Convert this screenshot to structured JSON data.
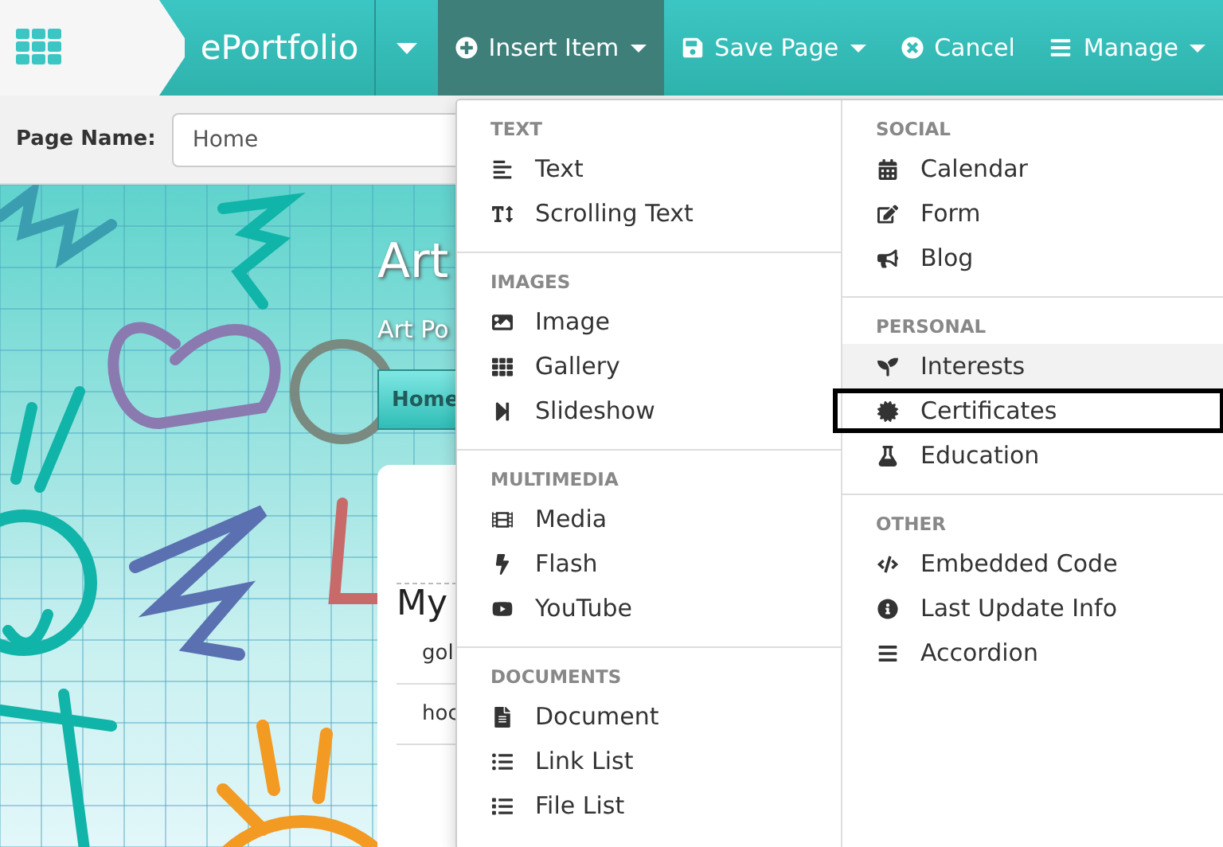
{
  "topbar": {
    "brand": "ePortfolio",
    "menus": [
      {
        "label": "Insert Item",
        "selected": true,
        "caret": true
      },
      {
        "label": "Save Page",
        "selected": false,
        "caret": true
      },
      {
        "label": "Cancel",
        "selected": false,
        "caret": false
      },
      {
        "label": "Manage",
        "selected": false,
        "caret": true
      }
    ]
  },
  "page_name": {
    "label": "Page Name:",
    "value": "Home"
  },
  "site": {
    "title": "Art",
    "subtitle": "Art Po",
    "nav_button": "Home",
    "card_heading": "My",
    "card_rows": [
      "gol",
      "hoc"
    ]
  },
  "insert_menu": {
    "columns": [
      [
        {
          "heading": "TEXT",
          "items": [
            {
              "label": "Text",
              "hovered": false,
              "outlined": false
            },
            {
              "label": "Scrolling Text",
              "hovered": false,
              "outlined": false
            }
          ]
        },
        {
          "heading": "IMAGES",
          "items": [
            {
              "label": "Image",
              "hovered": false,
              "outlined": false
            },
            {
              "label": "Gallery",
              "hovered": false,
              "outlined": false
            },
            {
              "label": "Slideshow",
              "hovered": false,
              "outlined": false
            }
          ]
        },
        {
          "heading": "MULTIMEDIA",
          "items": [
            {
              "label": "Media",
              "hovered": false,
              "outlined": false
            },
            {
              "label": "Flash",
              "hovered": false,
              "outlined": false
            },
            {
              "label": "YouTube",
              "hovered": false,
              "outlined": false
            }
          ]
        },
        {
          "heading": "DOCUMENTS",
          "items": [
            {
              "label": "Document",
              "hovered": false,
              "outlined": false
            },
            {
              "label": "Link List",
              "hovered": false,
              "outlined": false
            },
            {
              "label": "File List",
              "hovered": false,
              "outlined": false
            }
          ]
        }
      ],
      [
        {
          "heading": "SOCIAL",
          "items": [
            {
              "label": "Calendar",
              "hovered": false,
              "outlined": false
            },
            {
              "label": "Form",
              "hovered": false,
              "outlined": false
            },
            {
              "label": "Blog",
              "hovered": false,
              "outlined": false
            }
          ]
        },
        {
          "heading": "PERSONAL",
          "items": [
            {
              "label": "Interests",
              "hovered": true,
              "outlined": false
            },
            {
              "label": "Certificates",
              "hovered": false,
              "outlined": true
            },
            {
              "label": "Education",
              "hovered": false,
              "outlined": false
            }
          ]
        },
        {
          "heading": "OTHER",
          "items": [
            {
              "label": "Embedded Code",
              "hovered": false,
              "outlined": false
            },
            {
              "label": "Last Update Info",
              "hovered": false,
              "outlined": false
            },
            {
              "label": "Accordion",
              "hovered": false,
              "outlined": false
            }
          ]
        }
      ]
    ]
  }
}
